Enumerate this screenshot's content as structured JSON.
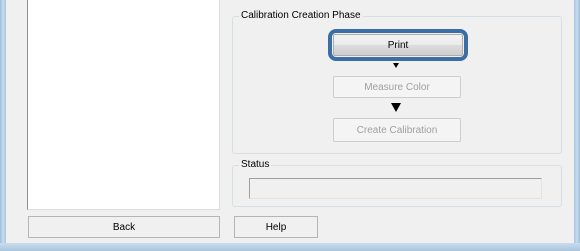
{
  "calibration_group": {
    "title": "Calibration Creation Phase",
    "buttons": {
      "print": "Print",
      "measure_color": "Measure Color",
      "create_calibration": "Create Calibration"
    },
    "icons": [
      "arrow-down-icon",
      "arrow-down-icon"
    ]
  },
  "status_group": {
    "title": "Status",
    "value": ""
  },
  "footer": {
    "back": "Back",
    "help": "Help"
  },
  "colors": {
    "highlight": "#3a6ea5",
    "disabled_text": "#a0a0a0",
    "frame": "#a9c4de"
  }
}
